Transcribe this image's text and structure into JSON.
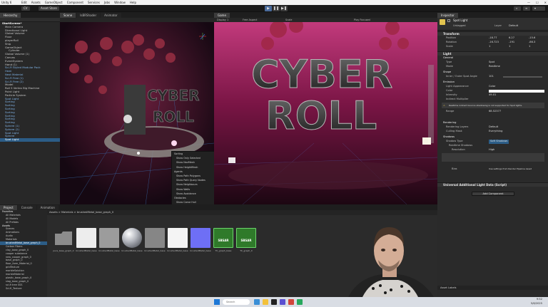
{
  "os_titlebar": {
    "app_title": "Unity 6",
    "menu": [
      "Edit",
      "Assets",
      "GameObject",
      "Component",
      "Services",
      "Jobs",
      "Window",
      "Help"
    ],
    "controls": [
      "—",
      "☐",
      "✕"
    ]
  },
  "toolbar": {
    "account_label": "CV",
    "asset_store_label": "Asset Store",
    "play_icons": [
      "▶",
      "❚❚",
      "▶❚"
    ]
  },
  "hierarchy": {
    "tab_label": "Hierarchy",
    "scene_name": "StartScreen*",
    "items": [
      "Main Camera",
      "Directional Light",
      "Global Volume",
      "Floor",
      "playerRoll",
      "Ship",
      "GameObject",
      "Cylinder",
      "Global Volume (1)",
      "Canvas",
      "EventSystem",
      "Hand (1)",
      "Sci-Fi Styled Modular Pack",
      "Heat",
      "Next Material",
      "Sci-Fi Free (1)",
      "Sci-Fi Free (2)",
      "Model",
      "Roll 5 Vertex Big Machine",
      "Point Light",
      "Particle System",
      "Spot Light",
      "Sorting",
      "Sorting",
      "Sorting",
      "Sorting",
      "Sorting",
      "Sorting",
      "Sorting",
      "Sphere (1)",
      "Sphere (2)",
      "Spot Light",
      "Sphere",
      "Spot Light"
    ]
  },
  "scene_view": {
    "tab_scene": "Scene",
    "tab_shader": "IsBRShader",
    "tab_animator": "Animator",
    "overlay_menu": [
      "Sorting",
      "Show Only Selected",
      "Show NavMesh",
      "Show HeightMesh",
      "Agents",
      "Show Path Polygons",
      "Show Path Query Nodes",
      "Show Neighbours",
      "Show Walls",
      "Show Avoidance",
      "Obstacles",
      "Show Carve Hull"
    ]
  },
  "game_view": {
    "tab_label": "Game",
    "display": "Display 1",
    "aspect": "Free Aspect",
    "scale": "Scale",
    "play_focused": "Play Focused",
    "title_line1": "CYBER",
    "title_line2": "ROLL"
  },
  "inspector": {
    "tab_inspector": "Inspector",
    "object_name": "Spot Light",
    "tag": "Untagged",
    "layer_label": "Layer",
    "layer": "Default",
    "transform": {
      "label": "Transform",
      "position": [
        "-18.77",
        "6.27",
        "-15.6"
      ],
      "rotation": [
        "-16.723",
        "-191",
        "-86.3"
      ],
      "scale": [
        "1",
        "1",
        "1"
      ]
    },
    "light": {
      "label": "Light",
      "general": "General",
      "type": "Spot",
      "mode": "Realtime",
      "shape": "Shape",
      "spot_angle_label": "Inner / Outer Spot Angle",
      "spot_angle": "101",
      "emission": "Emission",
      "light_appearance": "Light Appearance",
      "appearance": "Color",
      "color_label": "Color",
      "intensity_label": "Intensity",
      "intensity": "49.01",
      "indirect_label": "Indirect Multiplier",
      "range_label": "Range",
      "range": "68.52377",
      "culling_label": "Culling Mask",
      "culling": "Everything",
      "shadows": "Shadows",
      "shadow_type": "Soft Shadows",
      "realtime_shadows": "Realtime Shadows",
      "resolution": "High",
      "bias": "Use settings from Render Pipeline Asset",
      "rendering": "Rendering",
      "rendering_layers": "Default"
    },
    "additional_component": "Universal Additional Light Data (Script)",
    "add_component": "Add Component",
    "asset_labels": "Asset Labels",
    "warning": "Realtime indirect bounce shadowing is not supported for Spot lights."
  },
  "project": {
    "tab_project": "Project",
    "tab_console": "Console",
    "tab_animation": "Animation",
    "breadcrumb": "Assets > Materials > brushedMetal_base_graph_0",
    "tree": [
      "Favorites",
      "All Materials",
      "All Models",
      "All Prefabs",
      "Assets",
      "Scenes",
      "Animations",
      "Audio",
      "Materials",
      "brushedMetal_base_graph_0",
      "Carbon Fibers",
      "clay_base_graph_0",
      "cooper substance",
      "new_cooper_graph_0",
      "base_graph_0",
      "floor_form_Material_0",
      "gridTexture",
      "marbleSolution",
      "marbleMaterial",
      "plastic_base_graph_0",
      "slag_base_graph_0",
      "sci-fi tree SSS",
      "Sci-fi_Texture"
    ],
    "assets": [
      {
        "name": "pure_base_graph_0",
        "color": "#8c8c8c",
        "kind": "folder"
      },
      {
        "name": "brushedMetal_base",
        "color": "#ededed",
        "kind": "plain"
      },
      {
        "name": "brushedMetal_base",
        "color": "#9c9c9c",
        "kind": "plain"
      },
      {
        "name": "brushedMetal_base",
        "color": "#b5b8bf",
        "kind": "sphere"
      },
      {
        "name": "brushedMetal_base",
        "color": "#868686",
        "kind": "plain"
      },
      {
        "name": "brushedMetal_base",
        "color": "#f4f4f4",
        "kind": "plain"
      },
      {
        "name": "brushedMetal_base",
        "color": "#6e6ff5",
        "kind": "plain"
      },
      {
        "name": "TC_graph_base",
        "color": "#2f7a2a",
        "kind": "sbsar"
      },
      {
        "name": "TC_graph_0",
        "color": "#2f7a2a",
        "kind": "sbsar"
      }
    ],
    "sbsar_label": "SBSAR"
  },
  "taskbar": {
    "search_placeholder": "Search",
    "time": "9:52",
    "date": "5/6/2025"
  }
}
